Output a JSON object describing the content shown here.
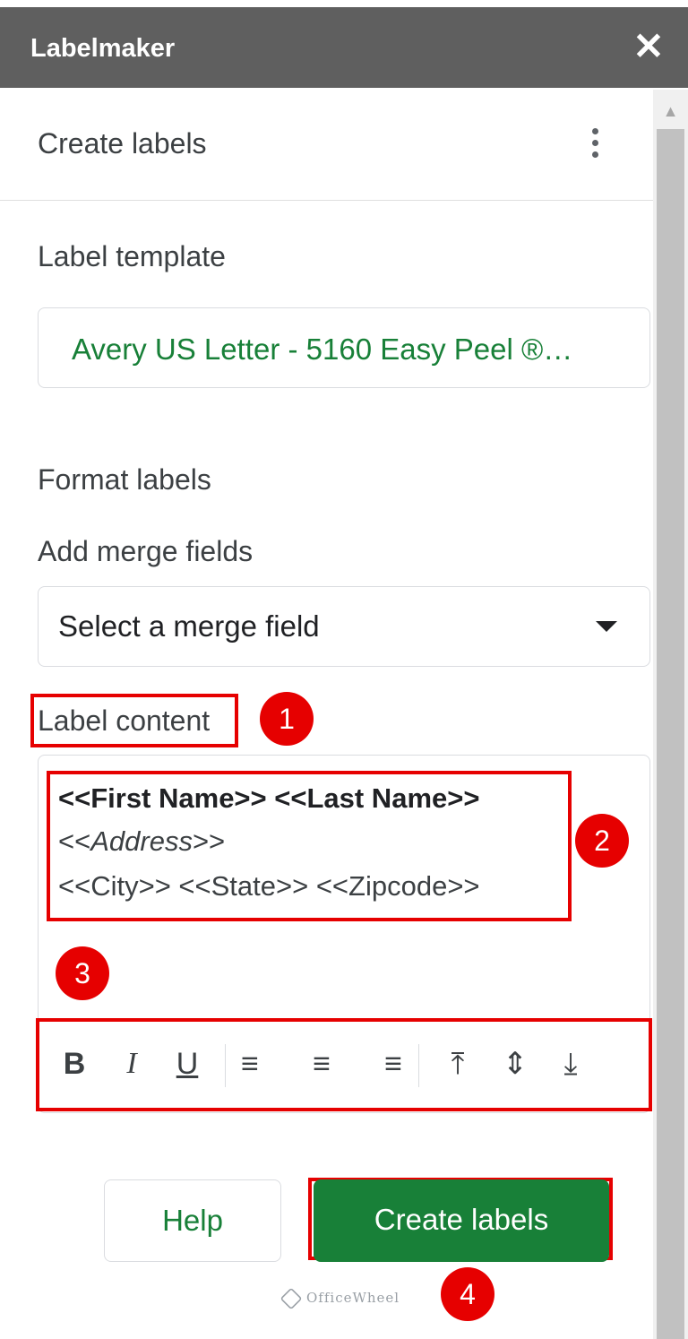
{
  "window": {
    "title": "Labelmaker",
    "close_glyph": "✕"
  },
  "scrollbar": {
    "up_arrow": "▲"
  },
  "panel": {
    "heading": "Create labels",
    "more_icon": "more-vert-icon"
  },
  "template": {
    "label": "Label template",
    "value": "Avery US Letter - 5160 Easy Peel ®…"
  },
  "format": {
    "section_label": "Format labels",
    "merge_label": "Add merge fields",
    "merge_select_value": "Select a merge field",
    "content_label": "Label content",
    "content_lines": {
      "line1": "<<First Name>> <<Last Name>>",
      "line2_prefix": "<<",
      "line2_italic": "Address",
      "line2_suffix": ">>",
      "line3": "<<City>> <<State>> <<Zipcode>>"
    },
    "toolbar": {
      "bold": "B",
      "italic": "I",
      "underline": "U",
      "align_left": "≡",
      "align_center": "≡",
      "align_right": "≡",
      "valign_top": "⤒",
      "valign_middle": "⇕",
      "valign_bottom": "⤓"
    }
  },
  "buttons": {
    "help": "Help",
    "create": "Create labels"
  },
  "annotations": {
    "badge1": "1",
    "badge2": "2",
    "badge3": "3",
    "badge4": "4",
    "color": "#e60000"
  },
  "watermark": {
    "text": "OfficeWheel"
  },
  "colors": {
    "accent_green": "#188038",
    "titlebar": "#5f5f5f"
  }
}
